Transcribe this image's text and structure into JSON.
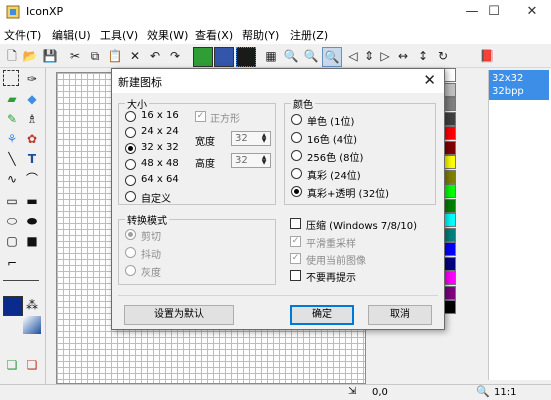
{
  "app": {
    "title": "IconXP"
  },
  "window_controls": {
    "minimize": "—",
    "maximize": "☐",
    "close": "✕"
  },
  "menu": [
    "文件(T)",
    "编辑(U)",
    "工具(V)",
    "效果(W)",
    "查看(X)",
    "帮助(Y)",
    "注册(Z)"
  ],
  "preview": {
    "size": "32x32",
    "depth": "32bpp"
  },
  "status": {
    "value": "0,0",
    "zoom": "11:1"
  },
  "dialog": {
    "title": "新建图标",
    "close": "✕",
    "size_group": {
      "label": "大小",
      "options": [
        "16 x 16",
        "24 x 24",
        "32 x 32",
        "48 x 48",
        "64 x 64",
        "自定义"
      ],
      "selected": "32 x 32",
      "square_label": "正方形",
      "width_label": "宽度",
      "width_value": "32",
      "height_label": "高度",
      "height_value": "32"
    },
    "color_group": {
      "label": "颜色",
      "options": [
        "单色 (1位)",
        "16色 (4位)",
        "256色 (8位)",
        "真彩 (24位)",
        "真彩+透明 (32位)"
      ],
      "selected": "真彩+透明 (32位)"
    },
    "convert_group": {
      "label": "转换模式",
      "options": [
        "剪切",
        "抖动",
        "灰度"
      ],
      "selected": "剪切"
    },
    "options": {
      "compress": "压缩 (Windows 7/8/10)",
      "smooth": "平滑重采样",
      "use_current": "使用当前图像",
      "no_prompt": "不要再提示"
    },
    "buttons": {
      "set_default": "设置为默认",
      "ok": "确定",
      "cancel": "取消"
    }
  },
  "colors": {
    "accent": "#0078d7",
    "selection": "#3d8ee6",
    "palette": [
      "#ffffff",
      "#c0c0c0",
      "#808080",
      "#404040",
      "#ff0000",
      "#800000",
      "#ffff00",
      "#808000",
      "#00ff00",
      "#008000",
      "#00ffff",
      "#008080",
      "#0000ff",
      "#000080",
      "#ff00ff",
      "#800080",
      "#000000"
    ]
  }
}
